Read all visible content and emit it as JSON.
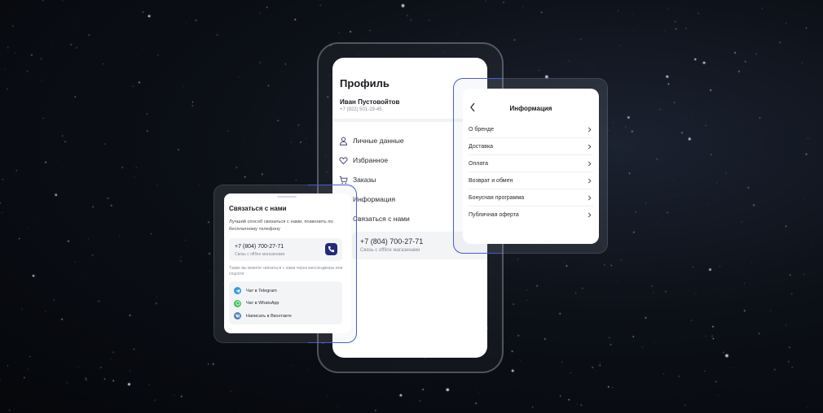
{
  "profile": {
    "title": "Профиль",
    "user_name": "Иван Пустовойтов",
    "user_phone": "+7 (922) 501-29-45",
    "menu": [
      {
        "label": "Личные данные",
        "icon": "person-icon"
      },
      {
        "label": "Избранное",
        "icon": "heart-icon"
      },
      {
        "label": "Заказы",
        "icon": "cart-icon"
      },
      {
        "label": "Информация",
        "icon": "info-icon"
      },
      {
        "label": "Связаться с нами",
        "icon": "chat-icon"
      }
    ],
    "contact_phone": "+7 (804) 700-27-71",
    "contact_sub": "Связь с offline магазинами"
  },
  "info": {
    "title": "Информация",
    "items": [
      {
        "label": "О бренде"
      },
      {
        "label": "Доставка"
      },
      {
        "label": "Оплата"
      },
      {
        "label": "Возврат и обмен"
      },
      {
        "label": "Бонусная программа"
      },
      {
        "label": "Публичная оферта"
      }
    ]
  },
  "contact": {
    "title": "Связаться с нами",
    "description": "Лучший способ связаться с нами, позвонить по бесплатному телефону",
    "phone": "+7 (804) 700-27-71",
    "phone_sub": "Связь с offline магазинами",
    "note": "Также вы можете связаться с нами через мессенджеры или соцсети",
    "messengers": [
      {
        "label": "Чат в Telegram",
        "icon": "telegram-icon",
        "color": "#2f9fd8"
      },
      {
        "label": "Чат в WhatsApp",
        "icon": "whatsapp-icon",
        "color": "#3ec45a"
      },
      {
        "label": "Написать в Вконтакте",
        "icon": "vk-icon",
        "color": "#5181b8"
      }
    ]
  },
  "colors": {
    "accent": "#4a5bd8",
    "call_button": "#232a7a"
  }
}
